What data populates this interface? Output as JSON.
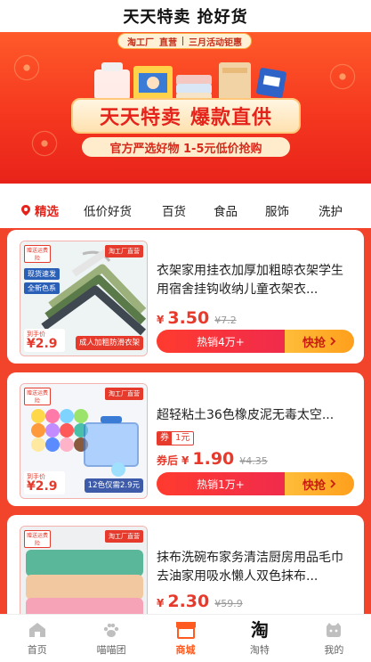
{
  "header": {
    "title": "天天特卖 抢好货"
  },
  "banner": {
    "factory_label": "淘工厂",
    "factory_sub": "直营",
    "event_label": "三月活动钜惠",
    "headline_left": "天天特卖",
    "headline_right": "爆款直供",
    "subline": "官方严选好物 1-5元低价抢购"
  },
  "tabs": [
    {
      "label": "精选",
      "active": true,
      "icon": "location-pin-icon"
    },
    {
      "label": "低价好货"
    },
    {
      "label": "百货"
    },
    {
      "label": "食品"
    },
    {
      "label": "服饰"
    },
    {
      "label": "洗护"
    }
  ],
  "products": [
    {
      "title": "衣架家用挂衣加厚加粗晾衣架学生用宿舍挂钩收纳儿童衣架衣...",
      "price_symbol": "¥",
      "price": "3.50",
      "old_price": "¥7.2",
      "hot_label": "热销4万+",
      "buy_label": "快抢",
      "thumb": {
        "mail_tag": "赠送运费险",
        "factory_tag": "淘工厂直营",
        "badges": [
          "现货速发",
          "全新色系"
        ],
        "price_label": "到手价",
        "price_value": "¥2.9",
        "caption": "成人加粗防滑衣架"
      }
    },
    {
      "title": "超轻粘土36色橡皮泥无毒太空...",
      "coupon_label": "券",
      "coupon_value": "1元",
      "after_label": "券后",
      "price_symbol": "¥",
      "price": "1.90",
      "old_price": "¥4.35",
      "hot_label": "热销1万+",
      "buy_label": "快抢",
      "thumb": {
        "mail_tag": "赠送运费险",
        "factory_tag": "淘工厂直营",
        "price_label": "到手价",
        "price_value": "¥2.9",
        "caption": "12色仅需2.9元"
      }
    },
    {
      "title": "抹布洗碗布家务清洁厨房用品毛巾去油家用吸水懒人双色抹布...",
      "price_symbol": "¥",
      "price": "2.30",
      "old_price": "¥59.9",
      "thumb": {
        "mail_tag": "赠送运费险",
        "factory_tag": "淘工厂直营"
      }
    }
  ],
  "bottom_nav": [
    {
      "label": "首页",
      "icon": "home-icon"
    },
    {
      "label": "喵喵团",
      "icon": "paw-icon"
    },
    {
      "label": "商城",
      "icon": "store-icon",
      "active": true
    },
    {
      "label": "淘特",
      "icon": "taote-logo-icon",
      "glyph": "淘"
    },
    {
      "label": "我的",
      "icon": "profile-icon"
    }
  ],
  "colors": {
    "accent": "#e5231a",
    "active_nav": "#ff5a1f",
    "buy_button": "#ffaa2a"
  }
}
